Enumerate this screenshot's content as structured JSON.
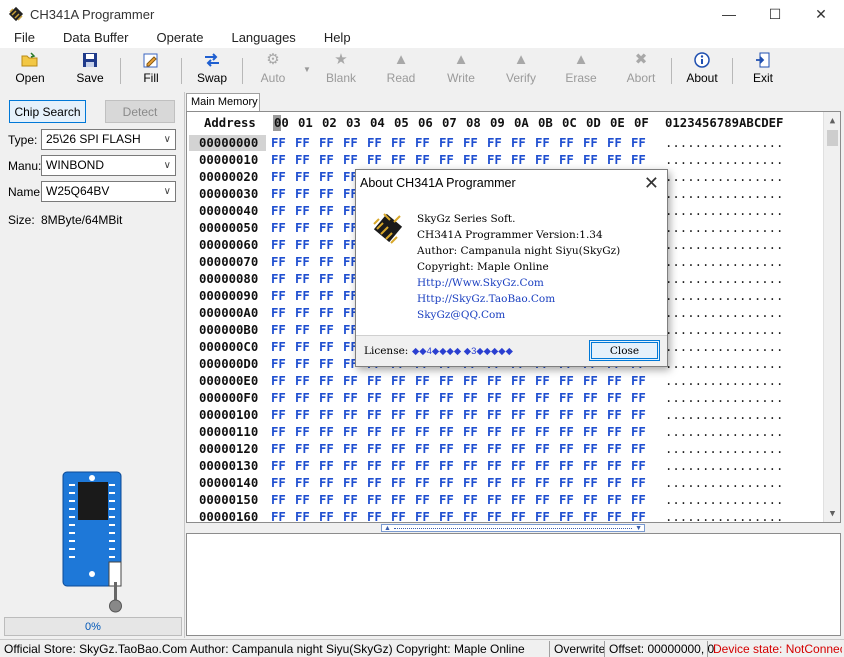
{
  "window": {
    "title": "CH341A Programmer"
  },
  "menu": [
    "File",
    "Data Buffer",
    "Operate",
    "Languages",
    "Help"
  ],
  "toolbar": {
    "open": "Open",
    "save": "Save",
    "fill": "Fill",
    "swap": "Swap",
    "auto": "Auto",
    "blank": "Blank",
    "read": "Read",
    "write": "Write",
    "verify": "Verify",
    "erase": "Erase",
    "abort": "Abort",
    "about": "About",
    "exit": "Exit"
  },
  "left": {
    "chip_search": "Chip Search",
    "detect": "Detect",
    "type_label": "Type:",
    "type_value": "25\\26 SPI FLASH",
    "manu_label": "Manu:",
    "manu_value": "WINBOND",
    "name_label": "Name:",
    "name_value": "W25Q64BV",
    "size_label": "Size:",
    "size_value": "8MByte/64MBit",
    "progress_text": "0%",
    "progress_fraction": 0
  },
  "tab": "Main Memory",
  "hex": {
    "address_header": "Address",
    "columns": [
      "00",
      "01",
      "02",
      "03",
      "04",
      "05",
      "06",
      "07",
      "08",
      "09",
      "0A",
      "0B",
      "0C",
      "0D",
      "0E",
      "0F"
    ],
    "ascii_header": "0123456789ABCDEF",
    "fill_byte": "FF",
    "fill_ascii": "................",
    "rows": [
      "00000000",
      "00000010",
      "00000020",
      "00000030",
      "00000040",
      "00000050",
      "00000060",
      "00000070",
      "00000080",
      "00000090",
      "000000A0",
      "000000B0",
      "000000C0",
      "000000D0",
      "000000E0",
      "000000F0",
      "00000100",
      "00000110",
      "00000120",
      "00000130",
      "00000140",
      "00000150",
      "00000160"
    ]
  },
  "status": {
    "store": "Official Store: SkyGz.TaoBao.Com Author: Campanula night Siyu(SkyGz) Copyright: Maple Online",
    "mode": "Overwrite",
    "offset": "Offset: 00000000, 0",
    "device": "Device state: NotConnect.",
    "device_color": "#d40000"
  },
  "dialog": {
    "title": "About CH341A Programmer",
    "lines": [
      "SkyGz Series Soft.",
      "CH341A Programmer Version:1.34",
      "Author: Campanula night Siyu(SkyGz)",
      "Copyright: Maple Online"
    ],
    "links": [
      "Http://Www.SkyGz.Com",
      "Http://SkyGz.TaoBao.Com",
      "SkyGz@QQ.Com"
    ],
    "license_label": "License:",
    "license_value": "◆◆4◆◆◆◆ ◆3◆◆◆◆◆",
    "close": "Close"
  }
}
